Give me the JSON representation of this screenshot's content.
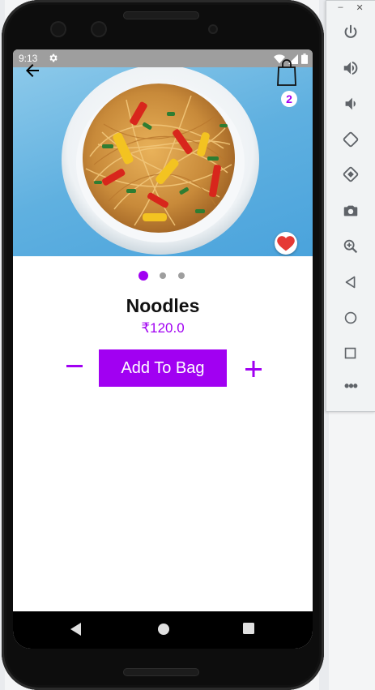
{
  "status_bar": {
    "time": "9:13"
  },
  "product": {
    "name": "Noodles",
    "price": "₹120.0",
    "add_to_bag_label": "Add To Bag",
    "quantity_decrement_symbol": "−",
    "quantity_increment_symbol": "+"
  },
  "header": {
    "bag_count": "2"
  },
  "carousel": {
    "active_index": 0,
    "total": 3
  },
  "emulator_window": {
    "minimize_symbol": "–",
    "close_symbol": "✕"
  },
  "colors": {
    "accent": "#a100f2",
    "favorite_heart": "#e53935",
    "status_bar_bg": "#9e9e9e",
    "nav_bar_bg": "#000000",
    "inactive_dot": "#9e9e9e"
  },
  "icons": [
    "back-arrow-icon",
    "shopping-bag-icon",
    "heart-icon",
    "power-icon",
    "volume-up-icon",
    "volume-down-icon",
    "rotate-left-icon",
    "rotate-right-icon",
    "camera-icon",
    "zoom-in-icon",
    "back-triangle-icon",
    "home-circle-icon",
    "overview-square-icon",
    "more-icon"
  ]
}
